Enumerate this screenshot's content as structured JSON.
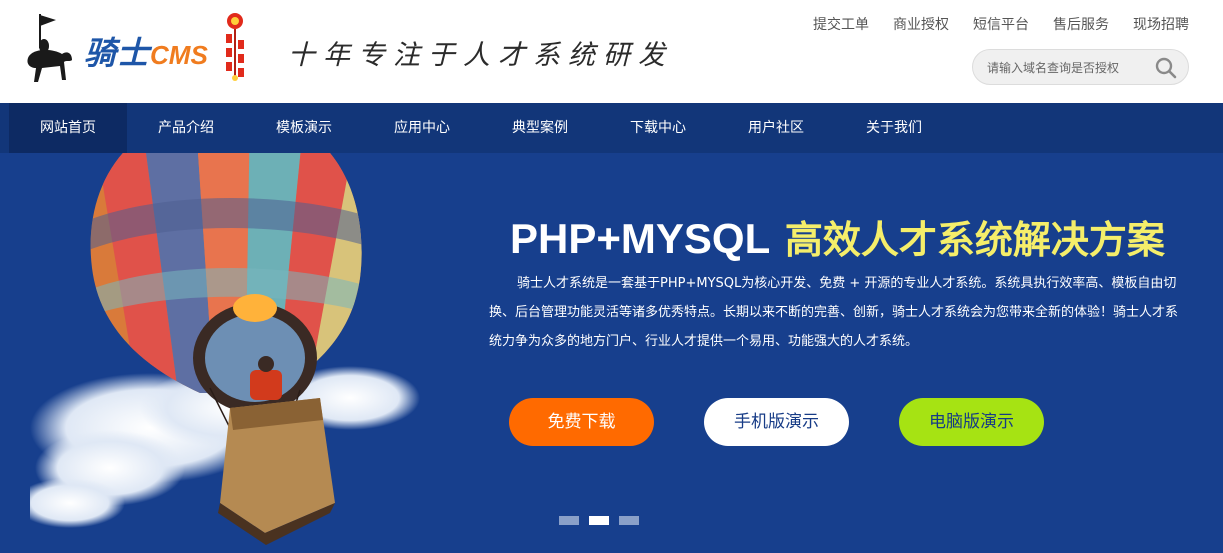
{
  "logo": {
    "name": "骑士",
    "suffix": "CMS"
  },
  "slogan": "十年专注于人才系统研发",
  "top_links": [
    "提交工单",
    "商业授权",
    "短信平台",
    "售后服务",
    "现场招聘"
  ],
  "search": {
    "placeholder": "请输入域名查询是否授权",
    "value": ""
  },
  "nav": {
    "items": [
      "网站首页",
      "产品介绍",
      "模板演示",
      "应用中心",
      "典型案例",
      "下载中心",
      "用户社区",
      "关于我们"
    ],
    "active_index": 0
  },
  "hero": {
    "title_en": "PHP+MYSQL",
    "title_cn": "高效人才系统解决方案",
    "description": "骑士人才系统是一套基于PHP+MYSQL为核心开发、免费 + 开源的专业人才系统。系统具执行效率高、模板自由切换、后台管理功能灵活等诸多优秀特点。长期以来不断的完善、创新，骑士人才系统会为您带来全新的体验！骑士人才系统力争为众多的地方门户、行业人才提供一个易用、功能强大的人才系统。",
    "buttons": {
      "download": "免费下载",
      "mobile": "手机版演示",
      "pc": "电脑版演示"
    }
  },
  "slider": {
    "slide_count": 3,
    "active_slide": 2
  },
  "colors": {
    "brand_blue": "#1e56a8",
    "brand_orange": "#f07c1f",
    "banner_bg": "#173f8d",
    "nav_bg": "#123679",
    "title_yellow": "#f5ee6a",
    "download_btn": "#ff6a00",
    "pc_btn": "#a6e313"
  },
  "icons": {
    "search": "search-icon",
    "logo": "knight-horse-icon",
    "firecracker": "firecracker-icon",
    "balloon": "hot-air-balloon-image"
  }
}
